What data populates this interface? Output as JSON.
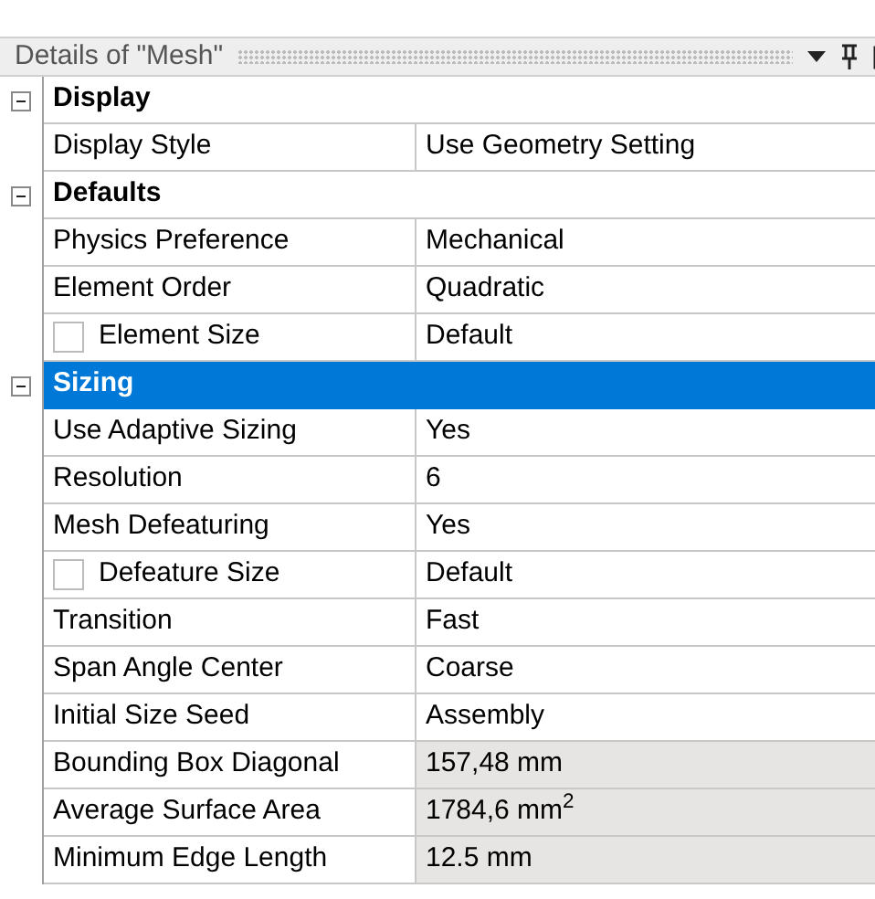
{
  "panel": {
    "title": "Details of \"Mesh\""
  },
  "sections": [
    {
      "label": "Display",
      "expanded": true,
      "selected": false,
      "rows": [
        {
          "kind": "plain",
          "label": "Display Style",
          "value": "Use Geometry Setting",
          "readonly": false
        }
      ]
    },
    {
      "label": "Defaults",
      "expanded": true,
      "selected": false,
      "rows": [
        {
          "kind": "plain",
          "label": "Physics Preference",
          "value": "Mechanical",
          "readonly": false
        },
        {
          "kind": "plain",
          "label": "Element Order",
          "value": "Quadratic",
          "readonly": false
        },
        {
          "kind": "checkbox",
          "checked": false,
          "label": "Element Size",
          "value": "Default",
          "readonly": false
        }
      ]
    },
    {
      "label": "Sizing",
      "expanded": true,
      "selected": true,
      "rows": [
        {
          "kind": "plain",
          "label": "Use Adaptive Sizing",
          "value": "Yes",
          "readonly": false
        },
        {
          "kind": "plain",
          "label": "Resolution",
          "value": "6",
          "readonly": false
        },
        {
          "kind": "plain",
          "label": "Mesh Defeaturing",
          "value": "Yes",
          "readonly": false
        },
        {
          "kind": "checkbox",
          "checked": false,
          "label": "Defeature Size",
          "value": "Default",
          "readonly": false
        },
        {
          "kind": "plain",
          "label": "Transition",
          "value": "Fast",
          "readonly": false
        },
        {
          "kind": "plain",
          "label": "Span Angle Center",
          "value": "Coarse",
          "readonly": false
        },
        {
          "kind": "plain",
          "label": "Initial Size Seed",
          "value": "Assembly",
          "readonly": false
        },
        {
          "kind": "plain",
          "label": "Bounding Box Diagonal",
          "value": "157,48 mm",
          "readonly": true
        },
        {
          "kind": "plain",
          "label": "Average Surface Area",
          "value": "1784,6 mm$^{2}$",
          "readonly": true
        },
        {
          "kind": "plain",
          "label": "Minimum Edge Length",
          "value": "12.5 mm",
          "readonly": true
        }
      ]
    }
  ]
}
